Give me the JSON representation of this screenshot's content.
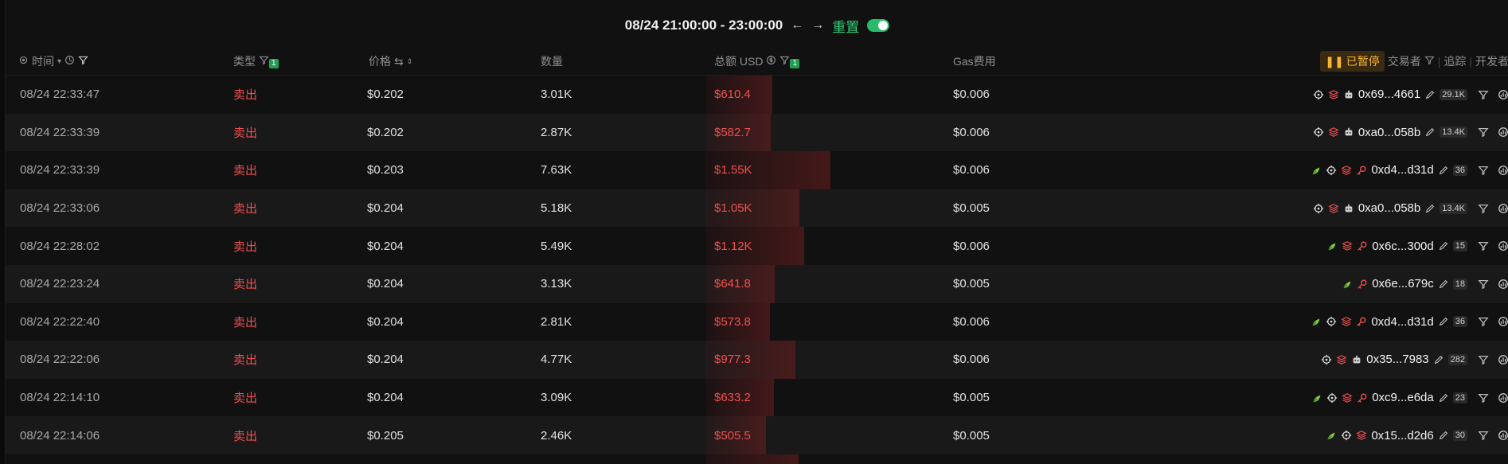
{
  "range": {
    "label": "08/24 21:00:00 - 23:00:00",
    "reset_label": "重置"
  },
  "header": {
    "time": "时间",
    "type": "类型",
    "type_filter_count": "1",
    "price": "价格",
    "qty": "数量",
    "total": "总额 USD",
    "total_filter_count": "1",
    "gas": "Gas费用",
    "paused": "已暂停",
    "trader": "交易者",
    "track": "追踪",
    "dev": "开发者"
  },
  "rows": [
    {
      "time": "08/24 22:33:47",
      "type": "卖出",
      "price": "$0.202",
      "qty": "3.01K",
      "total": "$610.4",
      "total_num": 610.4,
      "gas": "$0.006",
      "addr": "0x69...4661",
      "count": "29.1K",
      "tags": [
        "target",
        "layers",
        "bot"
      ]
    },
    {
      "time": "08/24 22:33:39",
      "type": "卖出",
      "price": "$0.202",
      "qty": "2.87K",
      "total": "$582.7",
      "total_num": 582.7,
      "gas": "$0.006",
      "addr": "0xa0...058b",
      "count": "13.4K",
      "tags": [
        "target",
        "layers",
        "bot"
      ]
    },
    {
      "time": "08/24 22:33:39",
      "type": "卖出",
      "price": "$0.203",
      "qty": "7.63K",
      "total": "$1.55K",
      "total_num": 1550,
      "gas": "$0.006",
      "addr": "0xd4...d31d",
      "count": "36",
      "tags": [
        "sprout",
        "target",
        "layers",
        "key"
      ]
    },
    {
      "time": "08/24 22:33:06",
      "type": "卖出",
      "price": "$0.204",
      "qty": "5.18K",
      "total": "$1.05K",
      "total_num": 1050,
      "gas": "$0.005",
      "addr": "0xa0...058b",
      "count": "13.4K",
      "tags": [
        "target",
        "layers",
        "bot"
      ]
    },
    {
      "time": "08/24 22:28:02",
      "type": "卖出",
      "price": "$0.204",
      "qty": "5.49K",
      "total": "$1.12K",
      "total_num": 1120,
      "gas": "$0.006",
      "addr": "0x6c...300d",
      "count": "15",
      "tags": [
        "sprout",
        "layers",
        "key"
      ]
    },
    {
      "time": "08/24 22:23:24",
      "type": "卖出",
      "price": "$0.204",
      "qty": "3.13K",
      "total": "$641.8",
      "total_num": 641.8,
      "gas": "$0.005",
      "addr": "0x6e...679c",
      "count": "18",
      "tags": [
        "sprout",
        "key"
      ]
    },
    {
      "time": "08/24 22:22:40",
      "type": "卖出",
      "price": "$0.204",
      "qty": "2.81K",
      "total": "$573.8",
      "total_num": 573.8,
      "gas": "$0.006",
      "addr": "0xd4...d31d",
      "count": "36",
      "tags": [
        "sprout",
        "target",
        "layers",
        "key"
      ]
    },
    {
      "time": "08/24 22:22:06",
      "type": "卖出",
      "price": "$0.204",
      "qty": "4.77K",
      "total": "$977.3",
      "total_num": 977.3,
      "gas": "$0.006",
      "addr": "0x35...7983",
      "count": "282",
      "tags": [
        "target",
        "layers",
        "bot"
      ]
    },
    {
      "time": "08/24 22:14:10",
      "type": "卖出",
      "price": "$0.204",
      "qty": "3.09K",
      "total": "$633.2",
      "total_num": 633.2,
      "gas": "$0.005",
      "addr": "0xc9...e6da",
      "count": "23",
      "tags": [
        "sprout",
        "target",
        "layers",
        "key"
      ]
    },
    {
      "time": "08/24 22:14:06",
      "type": "卖出",
      "price": "$0.205",
      "qty": "2.46K",
      "total": "$505.5",
      "total_num": 505.5,
      "gas": "$0.005",
      "addr": "0x15...d2d6",
      "count": "30",
      "tags": [
        "sprout",
        "target",
        "layers"
      ]
    }
  ],
  "colors": {
    "sell": "#f04f4f",
    "accent": "#2fd07a",
    "paused": "#f5b535",
    "tag_green": "#7ccf3a"
  }
}
